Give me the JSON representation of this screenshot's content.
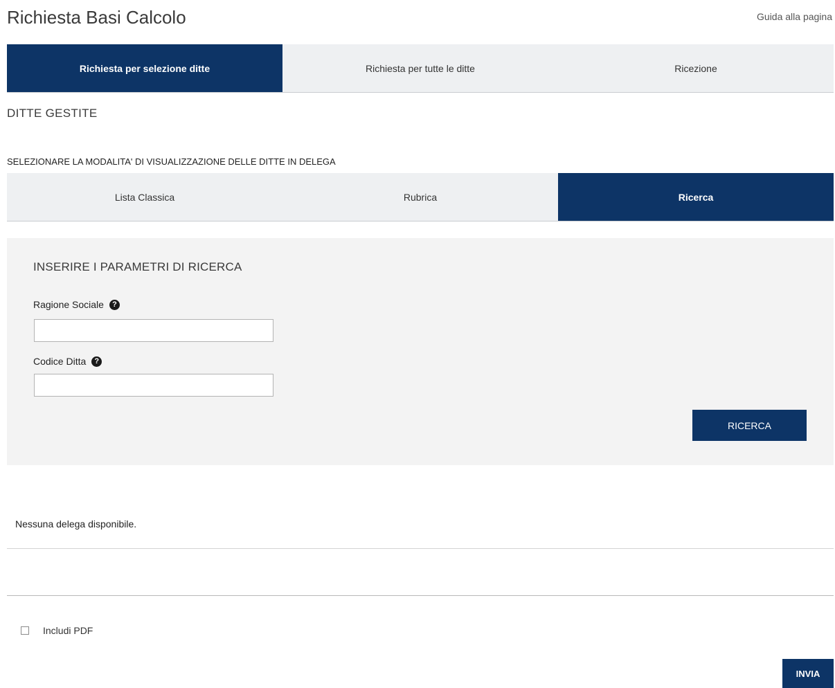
{
  "page": {
    "title": "Richiesta Basi Calcolo",
    "help_link": "Guida alla pagina"
  },
  "main_tabs": [
    {
      "label": "Richiesta per selezione ditte",
      "active": true
    },
    {
      "label": "Richiesta per tutte le ditte",
      "active": false
    },
    {
      "label": "Ricezione",
      "active": false
    }
  ],
  "section": {
    "title": "DITTE GESTITE",
    "mode_label": "SELEZIONARE LA MODALITA' DI VISUALIZZAZIONE DELLE DITTE IN DELEGA"
  },
  "view_tabs": [
    {
      "label": "Lista Classica",
      "active": false
    },
    {
      "label": "Rubrica",
      "active": false
    },
    {
      "label": "Ricerca",
      "active": true
    }
  ],
  "search": {
    "heading": "INSERIRE I PARAMETRI DI RICERCA",
    "fields": [
      {
        "label": "Ragione Sociale",
        "value": "",
        "placeholder": "",
        "help_icon": "question-circle-icon"
      },
      {
        "label": "Codice Ditta",
        "value": "",
        "placeholder": "",
        "help_icon": "question-circle-icon"
      }
    ],
    "button_label": "RICERCA"
  },
  "results": {
    "empty_message": "Nessuna delega disponibile."
  },
  "options": {
    "include_pdf_label": "Includi PDF",
    "include_pdf_checked": false
  },
  "actions": {
    "send_label": "INVIA"
  },
  "colors": {
    "primary": "#0d3466",
    "tab_inactive": "#eef0f2",
    "panel_bg": "#f3f3f3"
  }
}
